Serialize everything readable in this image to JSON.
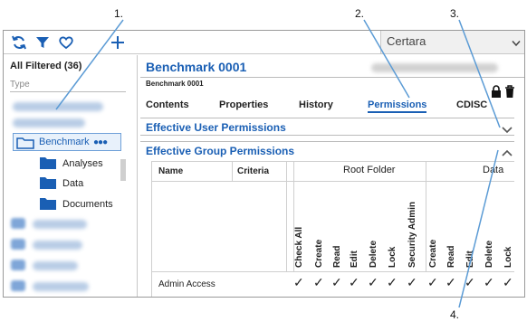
{
  "callouts": [
    "1.",
    "2.",
    "3.",
    "4."
  ],
  "toolbar": {
    "icons": [
      "refresh-icon",
      "filter-icon",
      "heart-icon",
      "plus-icon"
    ],
    "project_select": "Certara"
  },
  "sidebar": {
    "title": "All Filtered (36)",
    "type_label": "Type",
    "selected": {
      "label": "Benchmark",
      "more": "●●●"
    },
    "children": [
      {
        "label": "Analyses"
      },
      {
        "label": "Data"
      },
      {
        "label": "Documents"
      }
    ]
  },
  "object": {
    "title": "Benchmark 0001",
    "subtitle": "Benchmark 0001",
    "tabs": [
      {
        "label": "Contents",
        "active": false
      },
      {
        "label": "Properties",
        "active": false
      },
      {
        "label": "History",
        "active": false
      },
      {
        "label": "Permissions",
        "active": true
      },
      {
        "label": "CDISC",
        "active": false
      }
    ],
    "sections": [
      {
        "title": "Effective User Permissions",
        "state": "collapsed"
      },
      {
        "title": "Effective Group Permissions",
        "state": "expanded"
      }
    ]
  },
  "permissions_grid": {
    "col_name": "Name",
    "col_criteria": "Criteria",
    "groups": [
      "Root Folder",
      "Data"
    ],
    "columns": [
      "Check All",
      "Create",
      "Read",
      "Edit",
      "Delete",
      "Lock",
      "Security Admin",
      "Create",
      "Read",
      "Edit",
      "Delete",
      "Lock"
    ],
    "rows": [
      {
        "name": "Admin Access",
        "checks": [
          "✓",
          "✓",
          "✓",
          "✓",
          "✓",
          "✓",
          "✓",
          "✓",
          "✓",
          "✓",
          "✓",
          "✓"
        ]
      }
    ]
  },
  "colors": {
    "accent": "#1a5fb4",
    "callout_line": "#5b9bd5",
    "border": "#9a9a9a"
  }
}
